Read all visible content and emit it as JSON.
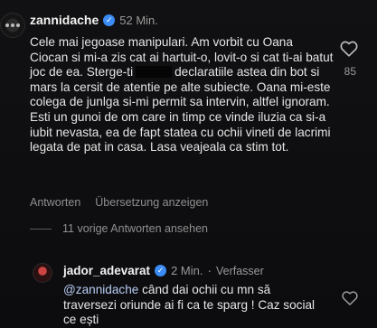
{
  "comment": {
    "username": "zannidache",
    "time": "52 Min.",
    "text_before_redact": "Cele mai jegoase manipulari. Am vorbit cu Oana Ciocan si mi-a zis cat ai hartuit-o, lovit-o si cat ti-ai batut joc de ea. Sterge-ti",
    "text_after_redact": "declaratiile astea din bot si mars la cersit de atentie pe alte subiecte. Oana mi-este colega de junlga si-mi permit sa intervin, altfel ignoram. Esti un gunoi de om care in timp ce vinde iluzia ca si-a iubit nevasta, ea de fapt statea cu ochii vineti de lacrimi legata de pat in casa. Lasa veajeala ca stim tot.",
    "like_count": "85",
    "reply_label": "Antworten",
    "translate_label": "Übersetzung anzeigen",
    "view_replies_label": "11 vorige Antworten ansehen"
  },
  "reply": {
    "username": "jador_adevarat",
    "time": "2 Min.",
    "author_badge": "Verfasser",
    "mention": "@zannidache",
    "text": " când dai ochii cu mn să traversezi oriunde ai fi ca te sparg ! Caz social ce ești"
  },
  "icons": {
    "verified": "verified-badge-icon",
    "like": "heart-outline-icon"
  },
  "colors": {
    "verified_blue": "#3b8cf5",
    "background": "#0d0d0f"
  }
}
